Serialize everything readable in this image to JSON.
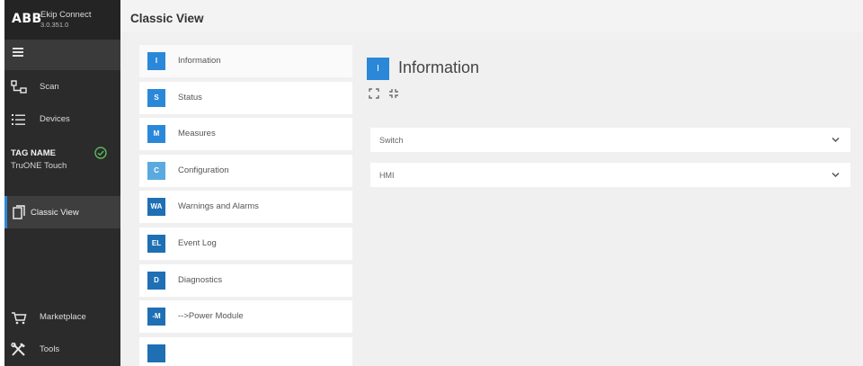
{
  "brand": {
    "logo": "ABB",
    "app_name": "Ekip Connect",
    "version": "3.0.351.0"
  },
  "sidebar": {
    "scan_label": "Scan",
    "devices_label": "Devices",
    "tag_name": "TAG NAME",
    "device_model": "TruONE Touch",
    "classic_view_label": "Classic View",
    "marketplace_label": "Marketplace",
    "tools_label": "Tools"
  },
  "header": {
    "title": "Classic View"
  },
  "menu_items": [
    {
      "badge": "I",
      "label": "Information",
      "color": "#2b88d8"
    },
    {
      "badge": "S",
      "label": "Status",
      "color": "#2b88d8"
    },
    {
      "badge": "M",
      "label": "Measures",
      "color": "#2b88d8"
    },
    {
      "badge": "C",
      "label": "Configuration",
      "color": "#5aaae0"
    },
    {
      "badge": "WA",
      "label": "Warnings and Alarms",
      "color": "#1f6fb5"
    },
    {
      "badge": "EL",
      "label": "Event Log",
      "color": "#1f6fb5"
    },
    {
      "badge": "D",
      "label": "Diagnostics",
      "color": "#1f6fb5"
    },
    {
      "badge": "-M",
      "label": "-->Power Module",
      "color": "#1f6fb5"
    }
  ],
  "detail": {
    "badge": "I",
    "title": "Information",
    "dropdowns": [
      {
        "label": "Switch"
      },
      {
        "label": "HMI"
      }
    ]
  },
  "colors": {
    "accent": "#2b88d8",
    "sidebar_bg": "#2b2b2b",
    "ok_green": "#5cb85c"
  }
}
